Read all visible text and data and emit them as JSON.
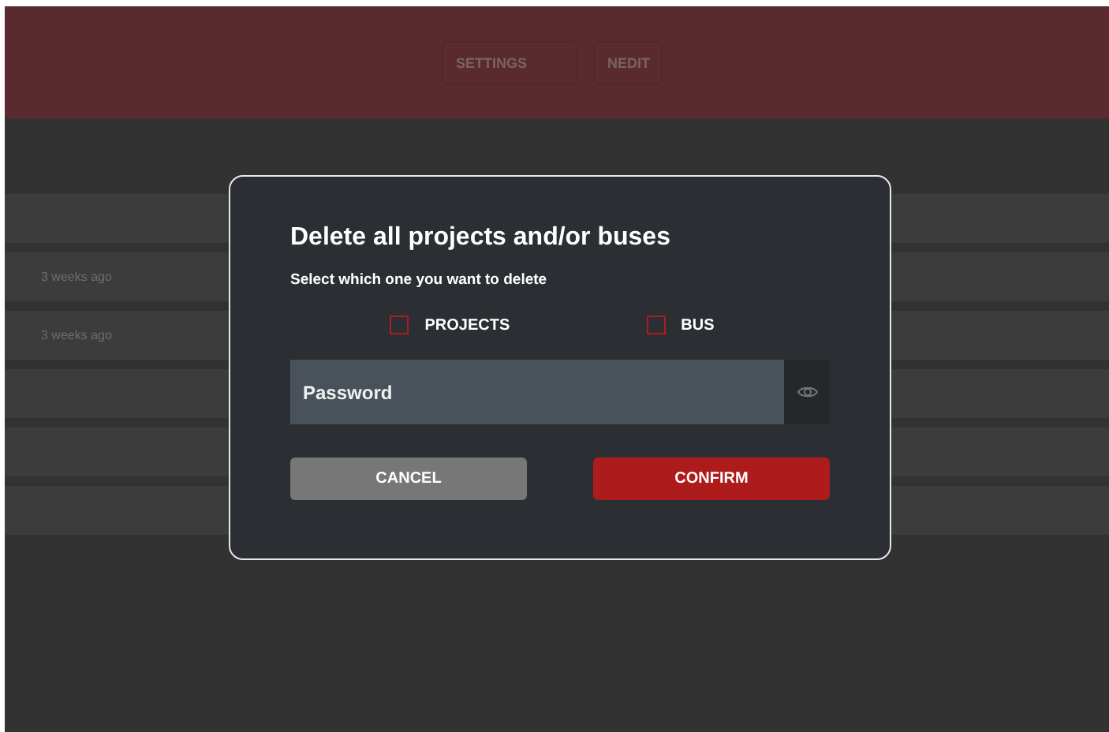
{
  "header": {
    "buttons": [
      "SETTINGS",
      "NEDIT"
    ]
  },
  "list": {
    "rows": [
      {
        "time": ""
      },
      {
        "time": "3 weeks ago"
      },
      {
        "time": "3 weeks ago"
      },
      {
        "time": ""
      },
      {
        "time": ""
      },
      {
        "time": ""
      }
    ]
  },
  "dialog": {
    "title": "Delete all projects and/or buses",
    "subtitle": "Select which one you want to delete",
    "options": [
      {
        "label": "PROJECTS",
        "checked": false
      },
      {
        "label": "BUS",
        "checked": false
      }
    ],
    "password": {
      "placeholder": "Password"
    },
    "buttons": [
      {
        "label": "CANCEL",
        "kind": "secondary"
      },
      {
        "label": "CONFIRM",
        "kind": "primary"
      }
    ]
  }
}
